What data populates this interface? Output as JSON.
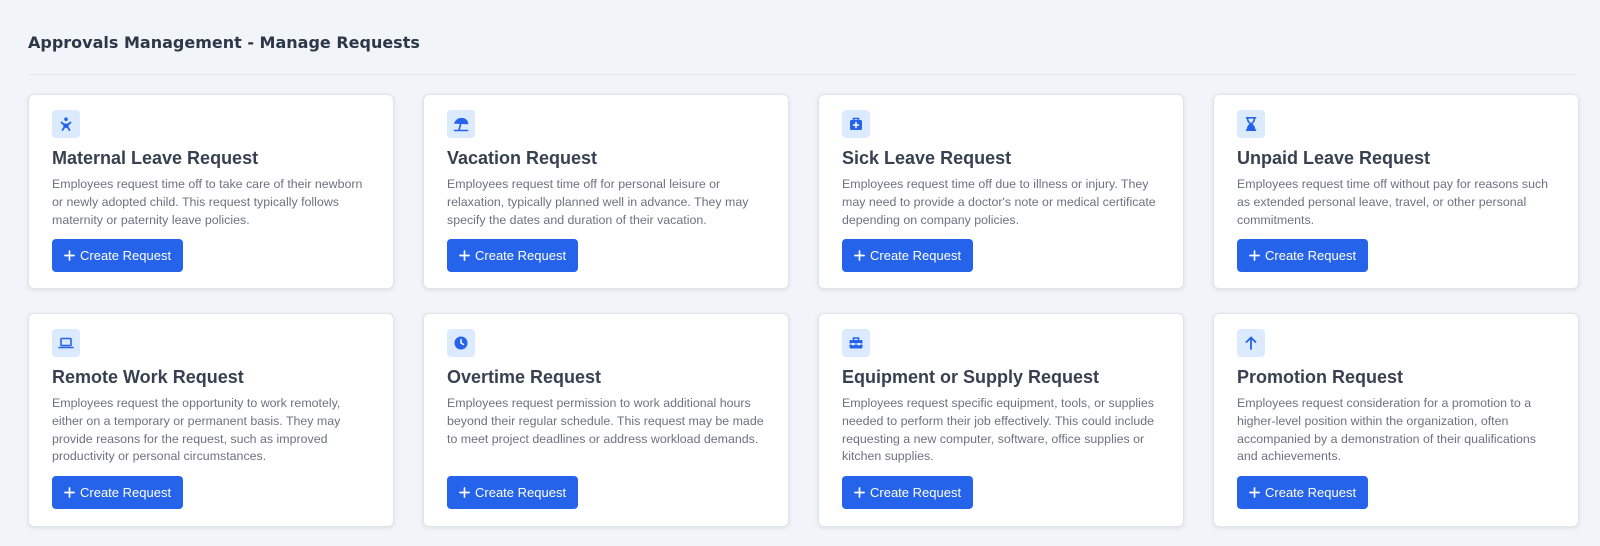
{
  "page": {
    "title": "Approvals Management - Manage Requests"
  },
  "colors": {
    "accent": "#2563eb",
    "icon_bg": "#dbeafe",
    "background": "#f1f4f8"
  },
  "cards": [
    {
      "icon": "baby-icon",
      "title": "Maternal Leave Request",
      "description": "Employees request time off to take care of their newborn or newly adopted child. This request typically follows maternity or paternity leave policies.",
      "button_label": "Create Request"
    },
    {
      "icon": "beach-umbrella-icon",
      "title": "Vacation Request",
      "description": "Employees request time off for personal leisure or relaxation, typically planned well in advance. They may specify the dates and duration of their vacation.",
      "button_label": "Create Request"
    },
    {
      "icon": "medical-kit-icon",
      "title": "Sick Leave Request",
      "description": "Employees request time off due to illness or injury. They may need to provide a doctor's note or medical certificate depending on company policies.",
      "button_label": "Create Request"
    },
    {
      "icon": "hourglass-icon",
      "title": "Unpaid Leave Request",
      "description": "Employees request time off without pay for reasons such as extended personal leave, travel, or other personal commitments.",
      "button_label": "Create Request"
    },
    {
      "icon": "laptop-icon",
      "title": "Remote Work Request",
      "description": "Employees request the opportunity to work remotely, either on a temporary or permanent basis. They may provide reasons for the request, such as improved productivity or personal circumstances.",
      "button_label": "Create Request"
    },
    {
      "icon": "clock-icon",
      "title": "Overtime Request",
      "description": "Employees request permission to work additional hours beyond their regular schedule. This request may be made to meet project deadlines or address workload demands.",
      "button_label": "Create Request"
    },
    {
      "icon": "toolbox-icon",
      "title": "Equipment or Supply Request",
      "description": "Employees request specific equipment, tools, or supplies needed to perform their job effectively. This could include requesting a new computer, software, office supplies or kitchen supplies.",
      "button_label": "Create Request"
    },
    {
      "icon": "arrow-up-icon",
      "title": "Promotion Request",
      "description": "Employees request consideration for a promotion to a higher-level position within the organization, often accompanied by a demonstration of their qualifications and achievements.",
      "button_label": "Create Request"
    }
  ]
}
